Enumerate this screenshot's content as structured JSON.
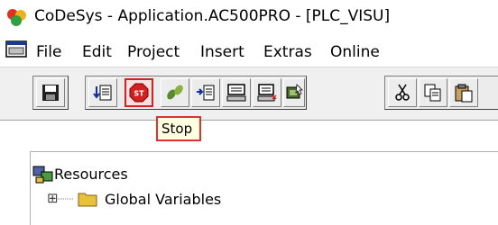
{
  "window": {
    "title": "CoDeSys - Application.AC500PRO - [PLC_VISU]"
  },
  "menu": {
    "items": [
      "File",
      "Edit",
      "Project",
      "Insert",
      "Extras",
      "Online"
    ]
  },
  "toolbar": {
    "buttons": [
      "save",
      "download",
      "stop",
      "run",
      "step-in",
      "login",
      "logout",
      "pointer-device",
      "cut",
      "copy",
      "paste"
    ],
    "active_button": "stop",
    "tooltip": "Stop"
  },
  "tree": {
    "root_label": "Resources",
    "child_label": "Global Variables",
    "expand_symbol": "⊞"
  },
  "colors": {
    "stop_red": "#d32020",
    "folder_yellow": "#e8c23a",
    "tooltip_bg": "#ffffe1"
  }
}
